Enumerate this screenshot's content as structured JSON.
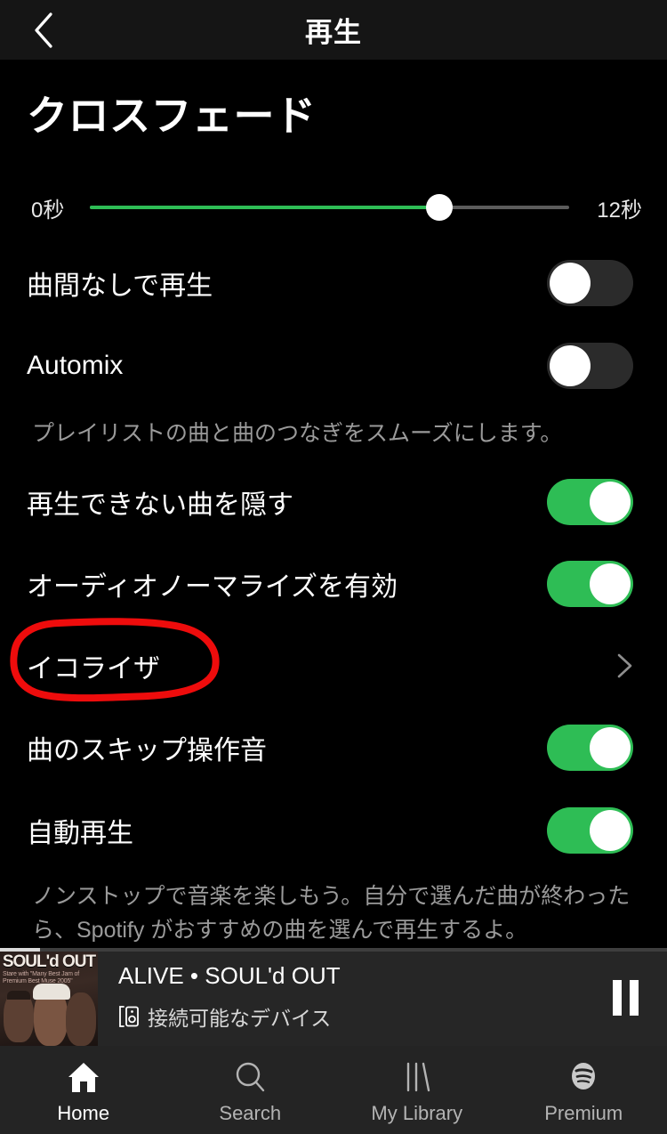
{
  "header": {
    "title": "再生",
    "back_icon": "chevron-left-icon"
  },
  "main": {
    "page_title": "クロスフェード",
    "crossfade_slider": {
      "min_label": "0秒",
      "max_label": "12秒",
      "min_value": 0,
      "max_value": 12,
      "value": 8.7,
      "fill_color": "#2ebd55",
      "track_color": "#5c5c5c"
    },
    "settings": [
      {
        "name": "gapless",
        "label": "曲間なしで再生",
        "control": "toggle",
        "state": "off"
      },
      {
        "name": "automix",
        "label": "Automix",
        "control": "toggle",
        "state": "off",
        "description": "プレイリストの曲と曲のつなぎをスムーズにします。"
      },
      {
        "name": "hide-unplayable",
        "label": "再生できない曲を隠す",
        "control": "toggle",
        "state": "on"
      },
      {
        "name": "audio-normalize",
        "label": "オーディオノーマライズを有効",
        "control": "toggle",
        "state": "on"
      },
      {
        "name": "equalizer",
        "label": "イコライザ",
        "control": "chevron",
        "annotated": true
      },
      {
        "name": "skip-sound",
        "label": "曲のスキップ操作音",
        "control": "toggle",
        "state": "on"
      },
      {
        "name": "autoplay",
        "label": "自動再生",
        "control": "toggle",
        "state": "on",
        "description": "ノンストップで音楽を楽しもう。自分で選んだ曲が終わったら、Spotify がおすすめの曲を選んで再生するよ。"
      }
    ],
    "annotation": {
      "type": "hand-drawn-ellipse",
      "color": "#ee0c0c",
      "target": "イコライザ"
    }
  },
  "now_playing": {
    "album_art_title": "SOUL'd OUT",
    "album_art_subtitle": "Stare with \"Many Best Jam of Premium Best Muse 2005\"",
    "track_line": "ALIVE • SOUL'd OUT",
    "device_label": "接続可能なデバイス",
    "device_icon": "device-speaker-icon",
    "pause_icon": "pause-icon",
    "progress_percent": 6
  },
  "bottom_nav": {
    "items": [
      {
        "label": "Home",
        "icon": "home-icon",
        "active": true
      },
      {
        "label": "Search",
        "icon": "search-icon",
        "active": false
      },
      {
        "label": "My Library",
        "icon": "library-icon",
        "active": false
      },
      {
        "label": "Premium",
        "icon": "spotify-logo-icon",
        "active": false
      }
    ]
  }
}
